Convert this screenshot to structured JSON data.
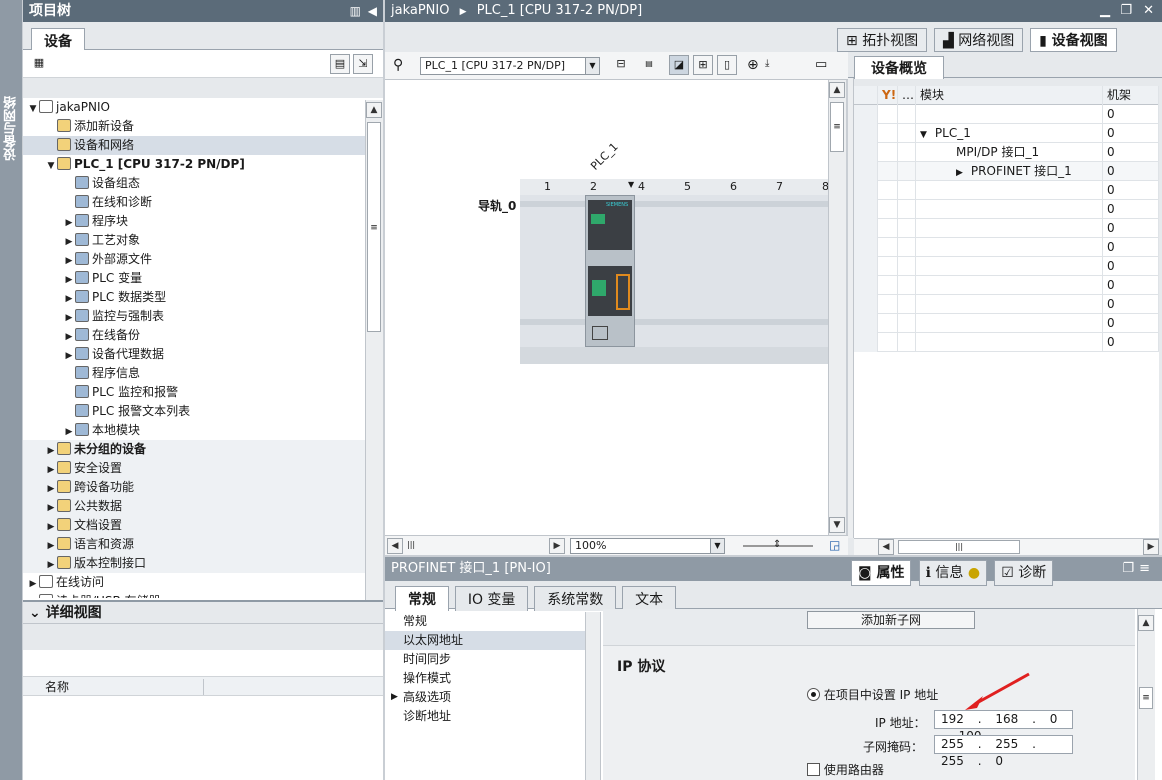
{
  "sidebar_tab": "设备与网络",
  "project_tree": {
    "title": "项目树",
    "tab": "设备",
    "items": [
      {
        "label": "jakaPNIO",
        "level": 0,
        "arrow": "▼"
      },
      {
        "label": "添加新设备",
        "level": 1,
        "arrow": ""
      },
      {
        "label": "设备和网络",
        "level": 1,
        "arrow": ""
      },
      {
        "label": "PLC_1 [CPU 317-2 PN/DP]",
        "level": 1,
        "arrow": "▼"
      },
      {
        "label": "设备组态",
        "level": 2,
        "arrow": ""
      },
      {
        "label": "在线和诊断",
        "level": 2,
        "arrow": ""
      },
      {
        "label": "程序块",
        "level": 2,
        "arrow": "▶"
      },
      {
        "label": "工艺对象",
        "level": 2,
        "arrow": "▶"
      },
      {
        "label": "外部源文件",
        "level": 2,
        "arrow": "▶"
      },
      {
        "label": "PLC 变量",
        "level": 2,
        "arrow": "▶"
      },
      {
        "label": "PLC 数据类型",
        "level": 2,
        "arrow": "▶"
      },
      {
        "label": "监控与强制表",
        "level": 2,
        "arrow": "▶"
      },
      {
        "label": "在线备份",
        "level": 2,
        "arrow": "▶"
      },
      {
        "label": "设备代理数据",
        "level": 2,
        "arrow": "▶"
      },
      {
        "label": "程序信息",
        "level": 2,
        "arrow": ""
      },
      {
        "label": "PLC 监控和报警",
        "level": 2,
        "arrow": ""
      },
      {
        "label": "PLC 报警文本列表",
        "level": 2,
        "arrow": ""
      },
      {
        "label": "本地模块",
        "level": 2,
        "arrow": "▶"
      },
      {
        "label": "未分组的设备",
        "level": 1,
        "arrow": "▶"
      },
      {
        "label": "安全设置",
        "level": 1,
        "arrow": "▶"
      },
      {
        "label": "跨设备功能",
        "level": 1,
        "arrow": "▶"
      },
      {
        "label": "公共数据",
        "level": 1,
        "arrow": "▶"
      },
      {
        "label": "文档设置",
        "level": 1,
        "arrow": "▶"
      },
      {
        "label": "语言和资源",
        "level": 1,
        "arrow": "▶"
      },
      {
        "label": "版本控制接口",
        "level": 1,
        "arrow": "▶"
      },
      {
        "label": "在线访问",
        "level": 0,
        "arrow": "▶"
      },
      {
        "label": "读卡器/USB 存储器",
        "level": 0,
        "arrow": "▶"
      }
    ]
  },
  "detail_view": {
    "title": "详细视图",
    "col_name": "名称"
  },
  "editor": {
    "breadcrumb": [
      "jakaPNIO",
      "PLC_1 [CPU 317-2 PN/DP]"
    ],
    "view_tabs": [
      "拓扑视图",
      "网络视图",
      "设备视图"
    ],
    "device_select": "PLC_1 [CPU 317-2 PN/DP]",
    "plc_label": "PLC_1",
    "rail_label": "导轨_0",
    "slots": [
      "1",
      "2",
      "4",
      "5",
      "6",
      "7",
      "8"
    ],
    "zoom": "100%",
    "cpu_brand": "SIEMENS"
  },
  "overview": {
    "tab": "设备概览",
    "columns": [
      "模块",
      "机架"
    ],
    "rows": [
      {
        "module": "",
        "rack": "0",
        "arrow": ""
      },
      {
        "module": "PLC_1",
        "rack": "0",
        "arrow": "▼"
      },
      {
        "module": "MPI/DP 接口_1",
        "rack": "0",
        "arrow": ""
      },
      {
        "module": "PROFINET 接口_1",
        "rack": "0",
        "arrow": "▶"
      },
      {
        "module": "",
        "rack": "0",
        "arrow": ""
      },
      {
        "module": "",
        "rack": "0",
        "arrow": ""
      },
      {
        "module": "",
        "rack": "0",
        "arrow": ""
      },
      {
        "module": "",
        "rack": "0",
        "arrow": ""
      },
      {
        "module": "",
        "rack": "0",
        "arrow": ""
      },
      {
        "module": "",
        "rack": "0",
        "arrow": ""
      },
      {
        "module": "",
        "rack": "0",
        "arrow": ""
      },
      {
        "module": "",
        "rack": "0",
        "arrow": ""
      },
      {
        "module": "",
        "rack": "0",
        "arrow": ""
      }
    ]
  },
  "properties": {
    "title": "PROFINET 接口_1 [PN-IO]",
    "right_tabs": [
      "属性",
      "信息",
      "诊断"
    ],
    "tabs": [
      "常规",
      "IO 变量",
      "系统常数",
      "文本"
    ],
    "nav": [
      "常规",
      "以太网地址",
      "时间同步",
      "操作模式",
      "高级选项",
      "诊断地址"
    ],
    "add_subnet": "添加新子网",
    "section": "IP 协议",
    "radio_label": "在项目中设置 IP 地址",
    "ip_label": "IP 地址：",
    "ip_value": "192 . 168 . 0 . 100",
    "mask_label": "子网掩码：",
    "mask_value": "255 . 255 . 255 . 0",
    "router_label": "使用路由器"
  }
}
